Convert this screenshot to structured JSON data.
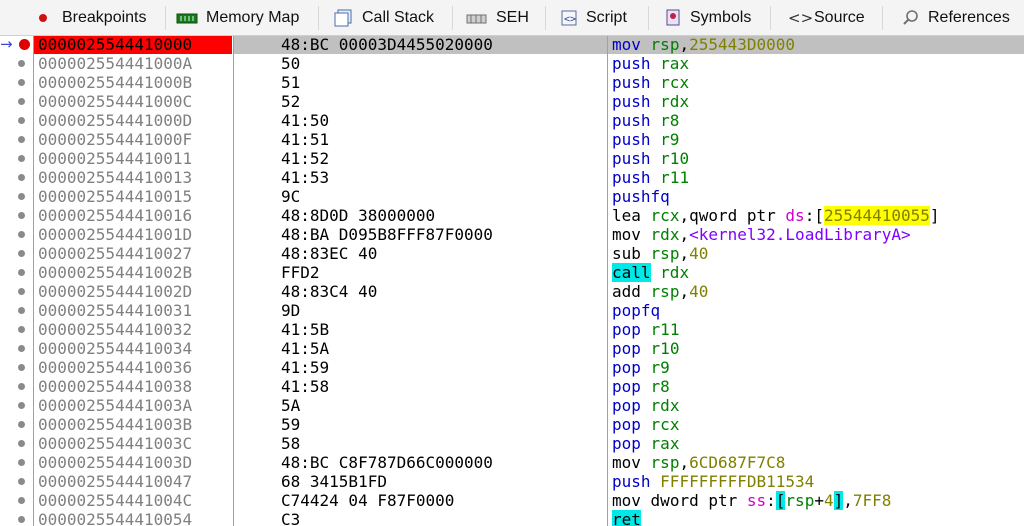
{
  "tabs": [
    {
      "label": "Breakpoints",
      "icon": "breakpoint-dot-icon"
    },
    {
      "label": "Memory Map",
      "icon": "memory-chip-icon"
    },
    {
      "label": "Call Stack",
      "icon": "call-stack-icon"
    },
    {
      "label": "SEH",
      "icon": "seh-icon"
    },
    {
      "label": "Script",
      "icon": "script-icon"
    },
    {
      "label": "Symbols",
      "icon": "symbols-icon"
    },
    {
      "label": "Source",
      "icon": "source-brackets-icon"
    },
    {
      "label": "References",
      "icon": "magnifier-icon"
    }
  ],
  "colors": {
    "current_address_bg": "#ff0000",
    "current_row_bg": "#c0c0c0",
    "mnemonic": "#0000c8",
    "register": "#008000",
    "immediate": "#808000",
    "symbol": "#8000ff",
    "highlight_cyan": "#00e8e8",
    "highlight_yellow": "#ffff00"
  },
  "rows": [
    {
      "addr": "0000025544410000",
      "bytes": "48:BC 00003D4455020000",
      "m": "mov",
      "ops": [
        [
          "reg",
          "rsp"
        ],
        [
          "p",
          ","
        ],
        [
          "imm",
          "255443D0000"
        ]
      ],
      "current": true
    },
    {
      "addr": "000002554441000A",
      "bytes": "50",
      "m": "push",
      "ops": [
        [
          "reg",
          "rax"
        ]
      ]
    },
    {
      "addr": "000002554441000B",
      "bytes": "51",
      "m": "push",
      "ops": [
        [
          "reg",
          "rcx"
        ]
      ]
    },
    {
      "addr": "000002554441000C",
      "bytes": "52",
      "m": "push",
      "ops": [
        [
          "reg",
          "rdx"
        ]
      ]
    },
    {
      "addr": "000002554441000D",
      "bytes": "41:50",
      "m": "push",
      "ops": [
        [
          "reg",
          "r8"
        ]
      ]
    },
    {
      "addr": "000002554441000F",
      "bytes": "41:51",
      "m": "push",
      "ops": [
        [
          "reg",
          "r9"
        ]
      ]
    },
    {
      "addr": "0000025544410011",
      "bytes": "41:52",
      "m": "push",
      "ops": [
        [
          "reg",
          "r10"
        ]
      ]
    },
    {
      "addr": "0000025544410013",
      "bytes": "41:53",
      "m": "push",
      "ops": [
        [
          "reg",
          "r11"
        ]
      ]
    },
    {
      "addr": "0000025544410015",
      "bytes": "9C",
      "m": "pushfq",
      "ops": []
    },
    {
      "addr": "0000025544410016",
      "bytes": "48:8D0D 38000000",
      "m": "lea",
      "mclass": "mn-lea",
      "ops": [
        [
          "reg",
          "rcx"
        ],
        [
          "p",
          ","
        ],
        [
          "kw",
          "qword ptr "
        ],
        [
          "seg",
          "ds"
        ],
        [
          "p",
          ":["
        ],
        [
          "hly",
          "25544410055"
        ],
        [
          "p",
          "]"
        ]
      ]
    },
    {
      "addr": "000002554441001D",
      "bytes": "48:BA D095B8FFF87F0000",
      "m": "mov",
      "mclass": "mn-mov",
      "ops": [
        [
          "reg",
          "rdx"
        ],
        [
          "p",
          ","
        ],
        [
          "sym",
          "<kernel32.LoadLibraryA>"
        ]
      ]
    },
    {
      "addr": "0000025544410027",
      "bytes": "48:83EC 40",
      "m": "sub",
      "mclass": "mn-mov",
      "ops": [
        [
          "reg",
          "rsp"
        ],
        [
          "p",
          ","
        ],
        [
          "imm",
          "40"
        ]
      ]
    },
    {
      "addr": "000002554441002B",
      "bytes": "FFD2",
      "m": "call",
      "mclass": "mn-hl",
      "ops": [
        [
          "reg",
          "rdx"
        ]
      ]
    },
    {
      "addr": "000002554441002D",
      "bytes": "48:83C4 40",
      "m": "add",
      "mclass": "mn-mov",
      "ops": [
        [
          "reg",
          "rsp"
        ],
        [
          "p",
          ","
        ],
        [
          "imm",
          "40"
        ]
      ]
    },
    {
      "addr": "0000025544410031",
      "bytes": "9D",
      "m": "popfq",
      "ops": []
    },
    {
      "addr": "0000025544410032",
      "bytes": "41:5B",
      "m": "pop",
      "ops": [
        [
          "reg",
          "r11"
        ]
      ]
    },
    {
      "addr": "0000025544410034",
      "bytes": "41:5A",
      "m": "pop",
      "ops": [
        [
          "reg",
          "r10"
        ]
      ]
    },
    {
      "addr": "0000025544410036",
      "bytes": "41:59",
      "m": "pop",
      "ops": [
        [
          "reg",
          "r9"
        ]
      ]
    },
    {
      "addr": "0000025544410038",
      "bytes": "41:58",
      "m": "pop",
      "ops": [
        [
          "reg",
          "r8"
        ]
      ]
    },
    {
      "addr": "000002554441003A",
      "bytes": "5A",
      "m": "pop",
      "ops": [
        [
          "reg",
          "rdx"
        ]
      ]
    },
    {
      "addr": "000002554441003B",
      "bytes": "59",
      "m": "pop",
      "ops": [
        [
          "reg",
          "rcx"
        ]
      ]
    },
    {
      "addr": "000002554441003C",
      "bytes": "58",
      "m": "pop",
      "ops": [
        [
          "reg",
          "rax"
        ]
      ]
    },
    {
      "addr": "000002554441003D",
      "bytes": "48:BC C8F787D66C000000",
      "m": "mov",
      "mclass": "mn-mov",
      "ops": [
        [
          "reg",
          "rsp"
        ],
        [
          "p",
          ","
        ],
        [
          "imm",
          "6CD687F7C8"
        ]
      ]
    },
    {
      "addr": "0000025544410047",
      "bytes": "68 3415B1FD",
      "m": "push",
      "ops": [
        [
          "imm",
          "FFFFFFFFFDB11534"
        ]
      ]
    },
    {
      "addr": "000002554441004C",
      "bytes": "C74424 04 F87F0000",
      "m": "mov",
      "mclass": "mn-mov",
      "ops": [
        [
          "kw",
          "dword ptr "
        ],
        [
          "seg",
          "ss"
        ],
        [
          "p",
          ":"
        ],
        [
          "brc",
          "["
        ],
        [
          "reg",
          "rsp"
        ],
        [
          "p",
          "+"
        ],
        [
          "imm",
          "4"
        ],
        [
          "brc",
          "]"
        ],
        [
          "p",
          ","
        ],
        [
          "imm",
          "7FF8"
        ]
      ]
    },
    {
      "addr": "0000025544410054",
      "bytes": "C3",
      "m": "ret",
      "mclass": "mn-hl",
      "ops": []
    }
  ]
}
